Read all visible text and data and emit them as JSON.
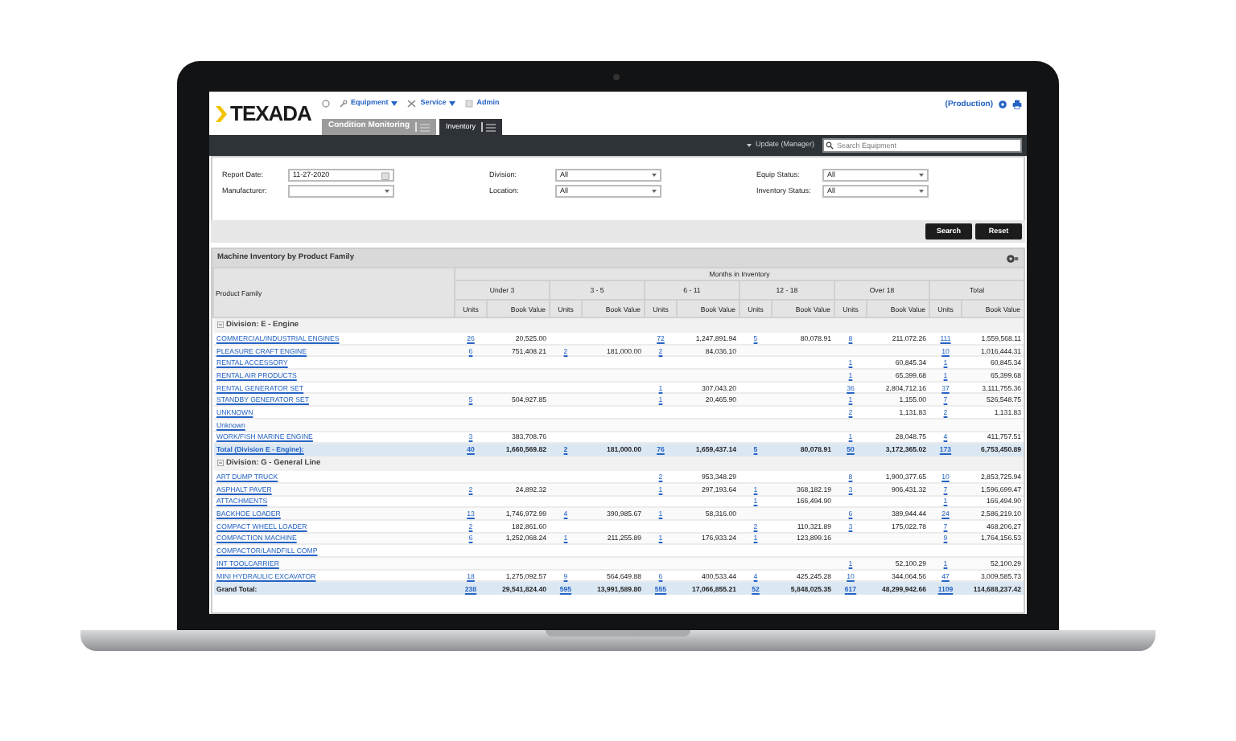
{
  "header": {
    "logo": "TEXADA",
    "nav": [
      {
        "label": "Equipment",
        "dropdown": true
      },
      {
        "label": "Service",
        "dropdown": true
      },
      {
        "label": "Admin",
        "dropdown": false
      }
    ],
    "tabs": [
      {
        "label": "Condition Monitoring",
        "selected": false
      },
      {
        "label": "Inventory",
        "selected": true
      }
    ],
    "environment": "(Production)"
  },
  "toolbar": {
    "user_menu": "Update (Manager)",
    "search": {
      "placeholder": "Search Equipment"
    }
  },
  "filters": [
    {
      "label": "Report Date:",
      "kind": "date",
      "value": "11-27-2020"
    },
    {
      "label": "Division:",
      "kind": "select",
      "value": "All"
    },
    {
      "label": "Equip Status:",
      "kind": "select",
      "value": "All"
    },
    {
      "label": "Manufacturer:",
      "kind": "select"
    },
    {
      "label": "Location:",
      "kind": "select",
      "value": "All"
    },
    {
      "label": "Inventory Status:",
      "kind": "select",
      "value": "All"
    }
  ],
  "buttons": [
    "Search",
    "Reset"
  ],
  "report": {
    "title": "Machine Inventory by Product Family",
    "first_column": "Product Family",
    "group_heading": "Months in Inventory",
    "groups": [
      {
        "label": "Under 3",
        "subcolumns": [
          "Units",
          "Book Value"
        ]
      },
      {
        "label": "3 - 5",
        "subcolumns": [
          "Units",
          "Book Value"
        ]
      },
      {
        "label": "6 - 11",
        "subcolumns": [
          "Units",
          "Book Value"
        ]
      },
      {
        "label": "12 - 18",
        "subcolumns": [
          "Units",
          "Book Value"
        ]
      },
      {
        "label": "Over 18",
        "subcolumns": [
          "Units",
          "Book Value"
        ]
      },
      {
        "label": "Total",
        "subcolumns": [
          "Units",
          "Book Value"
        ]
      }
    ],
    "sections": [
      {
        "division": "Division: E - Engine",
        "expanded": true,
        "rows": [
          {
            "family": "COMMERCIAL/INDUSTRIAL ENGINES",
            "cells": [
              "26",
              "20,525.00",
              null,
              null,
              "72",
              "1,247,891.94",
              "5",
              "80,078.91",
              "8",
              "211,072.26",
              "111",
              "1,559,568.11"
            ]
          },
          {
            "family": "PLEASURE CRAFT ENGINE",
            "cells": [
              "6",
              "751,408.21",
              "2",
              "181,000.00",
              "2",
              "84,036.10",
              null,
              null,
              null,
              null,
              "10",
              "1,016,444.31"
            ]
          },
          {
            "family": "RENTAL ACCESSORY",
            "cells": [
              null,
              null,
              null,
              null,
              null,
              null,
              null,
              null,
              "1",
              "60,845.34",
              "1",
              "60,845.34"
            ]
          },
          {
            "family": "RENTAL AIR PRODUCTS",
            "cells": [
              null,
              null,
              null,
              null,
              null,
              null,
              null,
              null,
              "1",
              "65,399.68",
              "1",
              "65,399.68"
            ]
          },
          {
            "family": "RENTAL GENERATOR SET",
            "cells": [
              null,
              null,
              null,
              null,
              "1",
              "307,043.20",
              null,
              null,
              "36",
              "2,804,712.16",
              "37",
              "3,111,755.36"
            ]
          },
          {
            "family": "STANDBY GENERATOR SET",
            "cells": [
              "5",
              "504,927.85",
              null,
              null,
              "1",
              "20,465.90",
              null,
              null,
              "1",
              "1,155.00",
              "7",
              "526,548.75"
            ]
          },
          {
            "family": "UNKNOWN",
            "cells": [
              null,
              null,
              null,
              null,
              null,
              null,
              null,
              null,
              "2",
              "1,131.83",
              "2",
              "1,131.83"
            ]
          },
          {
            "family": "Unknown",
            "cells": [
              null,
              null,
              null,
              null,
              null,
              null,
              null,
              null,
              null,
              null,
              null,
              null
            ]
          },
          {
            "family": "WORK/FISH MARINE ENGINE",
            "cells": [
              "3",
              "383,708.76",
              null,
              null,
              null,
              null,
              null,
              null,
              "1",
              "28,048.75",
              "4",
              "411,757.51"
            ]
          }
        ],
        "total": {
          "label": "Total (Division E - Engine):",
          "cells": [
            "40",
            "1,660,569.82",
            "2",
            "181,000.00",
            "76",
            "1,659,437.14",
            "5",
            "80,078.91",
            "50",
            "3,172,365.02",
            "173",
            "6,753,450.89"
          ]
        }
      },
      {
        "division": "Division: G - General Line",
        "expanded": true,
        "rows": [
          {
            "family": "ART DUMP TRUCK",
            "cells": [
              null,
              null,
              null,
              null,
              "2",
              "953,348.29",
              null,
              null,
              "8",
              "1,900,377.65",
              "10",
              "2,853,725.94"
            ]
          },
          {
            "family": "ASPHALT PAVER",
            "cells": [
              "2",
              "24,892.32",
              null,
              null,
              "1",
              "297,193.64",
              "1",
              "368,182.19",
              "3",
              "906,431.32",
              "7",
              "1,596,699.47"
            ]
          },
          {
            "family": "ATTACHMENTS",
            "cells": [
              null,
              null,
              null,
              null,
              null,
              null,
              "1",
              "166,494.90",
              null,
              null,
              "1",
              "166,494.90"
            ]
          },
          {
            "family": "BACKHOE LOADER",
            "cells": [
              "13",
              "1,746,972.99",
              "4",
              "390,985.67",
              "1",
              "58,316.00",
              null,
              null,
              "6",
              "389,944.44",
              "24",
              "2,586,219.10"
            ]
          },
          {
            "family": "COMPACT WHEEL LOADER",
            "cells": [
              "2",
              "182,861.60",
              null,
              null,
              null,
              null,
              "2",
              "110,321.89",
              "3",
              "175,022.78",
              "7",
              "468,206.27"
            ]
          },
          {
            "family": "COMPACTION MACHINE",
            "cells": [
              "6",
              "1,252,068.24",
              "1",
              "211,255.89",
              "1",
              "176,933.24",
              "1",
              "123,899.16",
              null,
              null,
              "9",
              "1,764,156.53"
            ]
          },
          {
            "family": "COMPACTOR/LANDFILL COMP",
            "cells": [
              null,
              null,
              null,
              null,
              null,
              null,
              null,
              null,
              null,
              null,
              null,
              null
            ]
          },
          {
            "family": "INT TOOLCARRIER",
            "cells": [
              null,
              null,
              null,
              null,
              null,
              null,
              null,
              null,
              "1",
              "52,100.29",
              "1",
              "52,100.29"
            ]
          },
          {
            "family": "MINI HYDRAULIC EXCAVATOR",
            "cells": [
              "18",
              "1,275,092.57",
              "9",
              "564,649.88",
              "6",
              "400,533.44",
              "4",
              "425,245.28",
              "10",
              "344,064.56",
              "47",
              "3,009,585.73"
            ]
          }
        ]
      }
    ],
    "grand_total": {
      "label": "Grand Total:",
      "cells": [
        "238",
        "29,541,824.40",
        "595",
        "13,991,589.80",
        "555",
        "17,066,855.21",
        "52",
        "5,848,025.35",
        "617",
        "48,299,942.66",
        "1109",
        "114,688,237.42"
      ]
    }
  }
}
